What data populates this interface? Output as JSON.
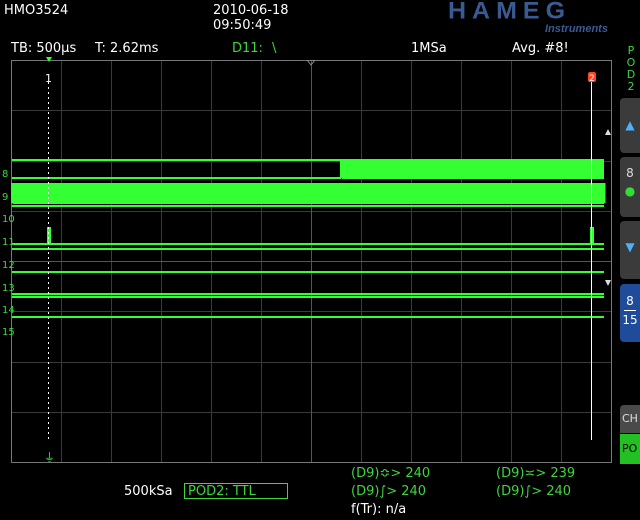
{
  "header": {
    "model": "HMO3524",
    "date": "2010-06-18",
    "time": "09:50:49",
    "logo_main": "HAMEG",
    "logo_sub": "Instruments"
  },
  "status_bar": {
    "timebase": "TB: 500µs",
    "trigger_time": "T: 2.62ms",
    "trigger_source_label": "D11:",
    "trigger_edge": "\\",
    "sample_rate": "1MSa",
    "averaging": "Avg. #8!"
  },
  "markers": {
    "cursor1": "1",
    "cursor2": "2"
  },
  "channels": [
    "8",
    "9",
    "10",
    "11",
    "12",
    "13",
    "14",
    "15"
  ],
  "sidebar": {
    "pod_label": [
      "P",
      "O",
      "D",
      "2"
    ],
    "up_arrow": "▲",
    "channel_num": "8",
    "channel_dot": "●",
    "down_arrow": "▼",
    "range_top": "8",
    "range_bottom": "15",
    "ch_tab": "CH",
    "po_tab": "PO"
  },
  "bottom": {
    "memory_rate": "500kSa",
    "pod_setting": "POD2: TTL",
    "count1": "(D9)≎> 240",
    "count2": "(D9)≍> 239",
    "count3": "(D9)∫> 240",
    "count4": "(D9)∫> 240",
    "frequency": "f(Tr): n/a"
  },
  "colors": {
    "trace": "#33ff33",
    "grid": "#444444",
    "logo": "#3a5a94",
    "cursor_red": "#ff4422",
    "sidebar_blue": "#2255aa"
  }
}
